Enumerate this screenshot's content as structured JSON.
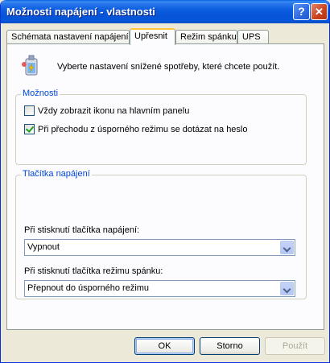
{
  "window": {
    "title": "Možnosti napájení - vlastnosti",
    "help_label": "?",
    "close_label": "✕"
  },
  "tabs": [
    {
      "label": "Schémata nastavení napájení"
    },
    {
      "label": "Upřesnit"
    },
    {
      "label": "Režim spánku"
    },
    {
      "label": "UPS"
    }
  ],
  "active_tab": "Upřesnit",
  "intro": {
    "icon": "power-options-icon",
    "text": "Vyberte nastavení snížené spotřeby, které chcete použít."
  },
  "options_group": {
    "title": "Možnosti",
    "checkboxes": [
      {
        "label": "Vždy zobrazit ikonu na hlavním panelu",
        "checked": false
      },
      {
        "label": "Při přechodu z úsporného režimu se dotázat na heslo",
        "checked": true
      }
    ]
  },
  "buttons_group": {
    "title": "Tlačítka napájení",
    "power_label": "Při stisknutí tlačítka napájení:",
    "power_value": "Vypnout",
    "sleep_label": "Při stisknutí tlačítka režimu spánku:",
    "sleep_value": "Přepnout do úsporného režimu"
  },
  "footer": {
    "ok": "OK",
    "cancel": "Storno",
    "apply": "Použít"
  },
  "colors": {
    "title_bar": "#0A5FE4",
    "group_title": "#0046D5",
    "active_tab_accent": "#FFC73C"
  }
}
